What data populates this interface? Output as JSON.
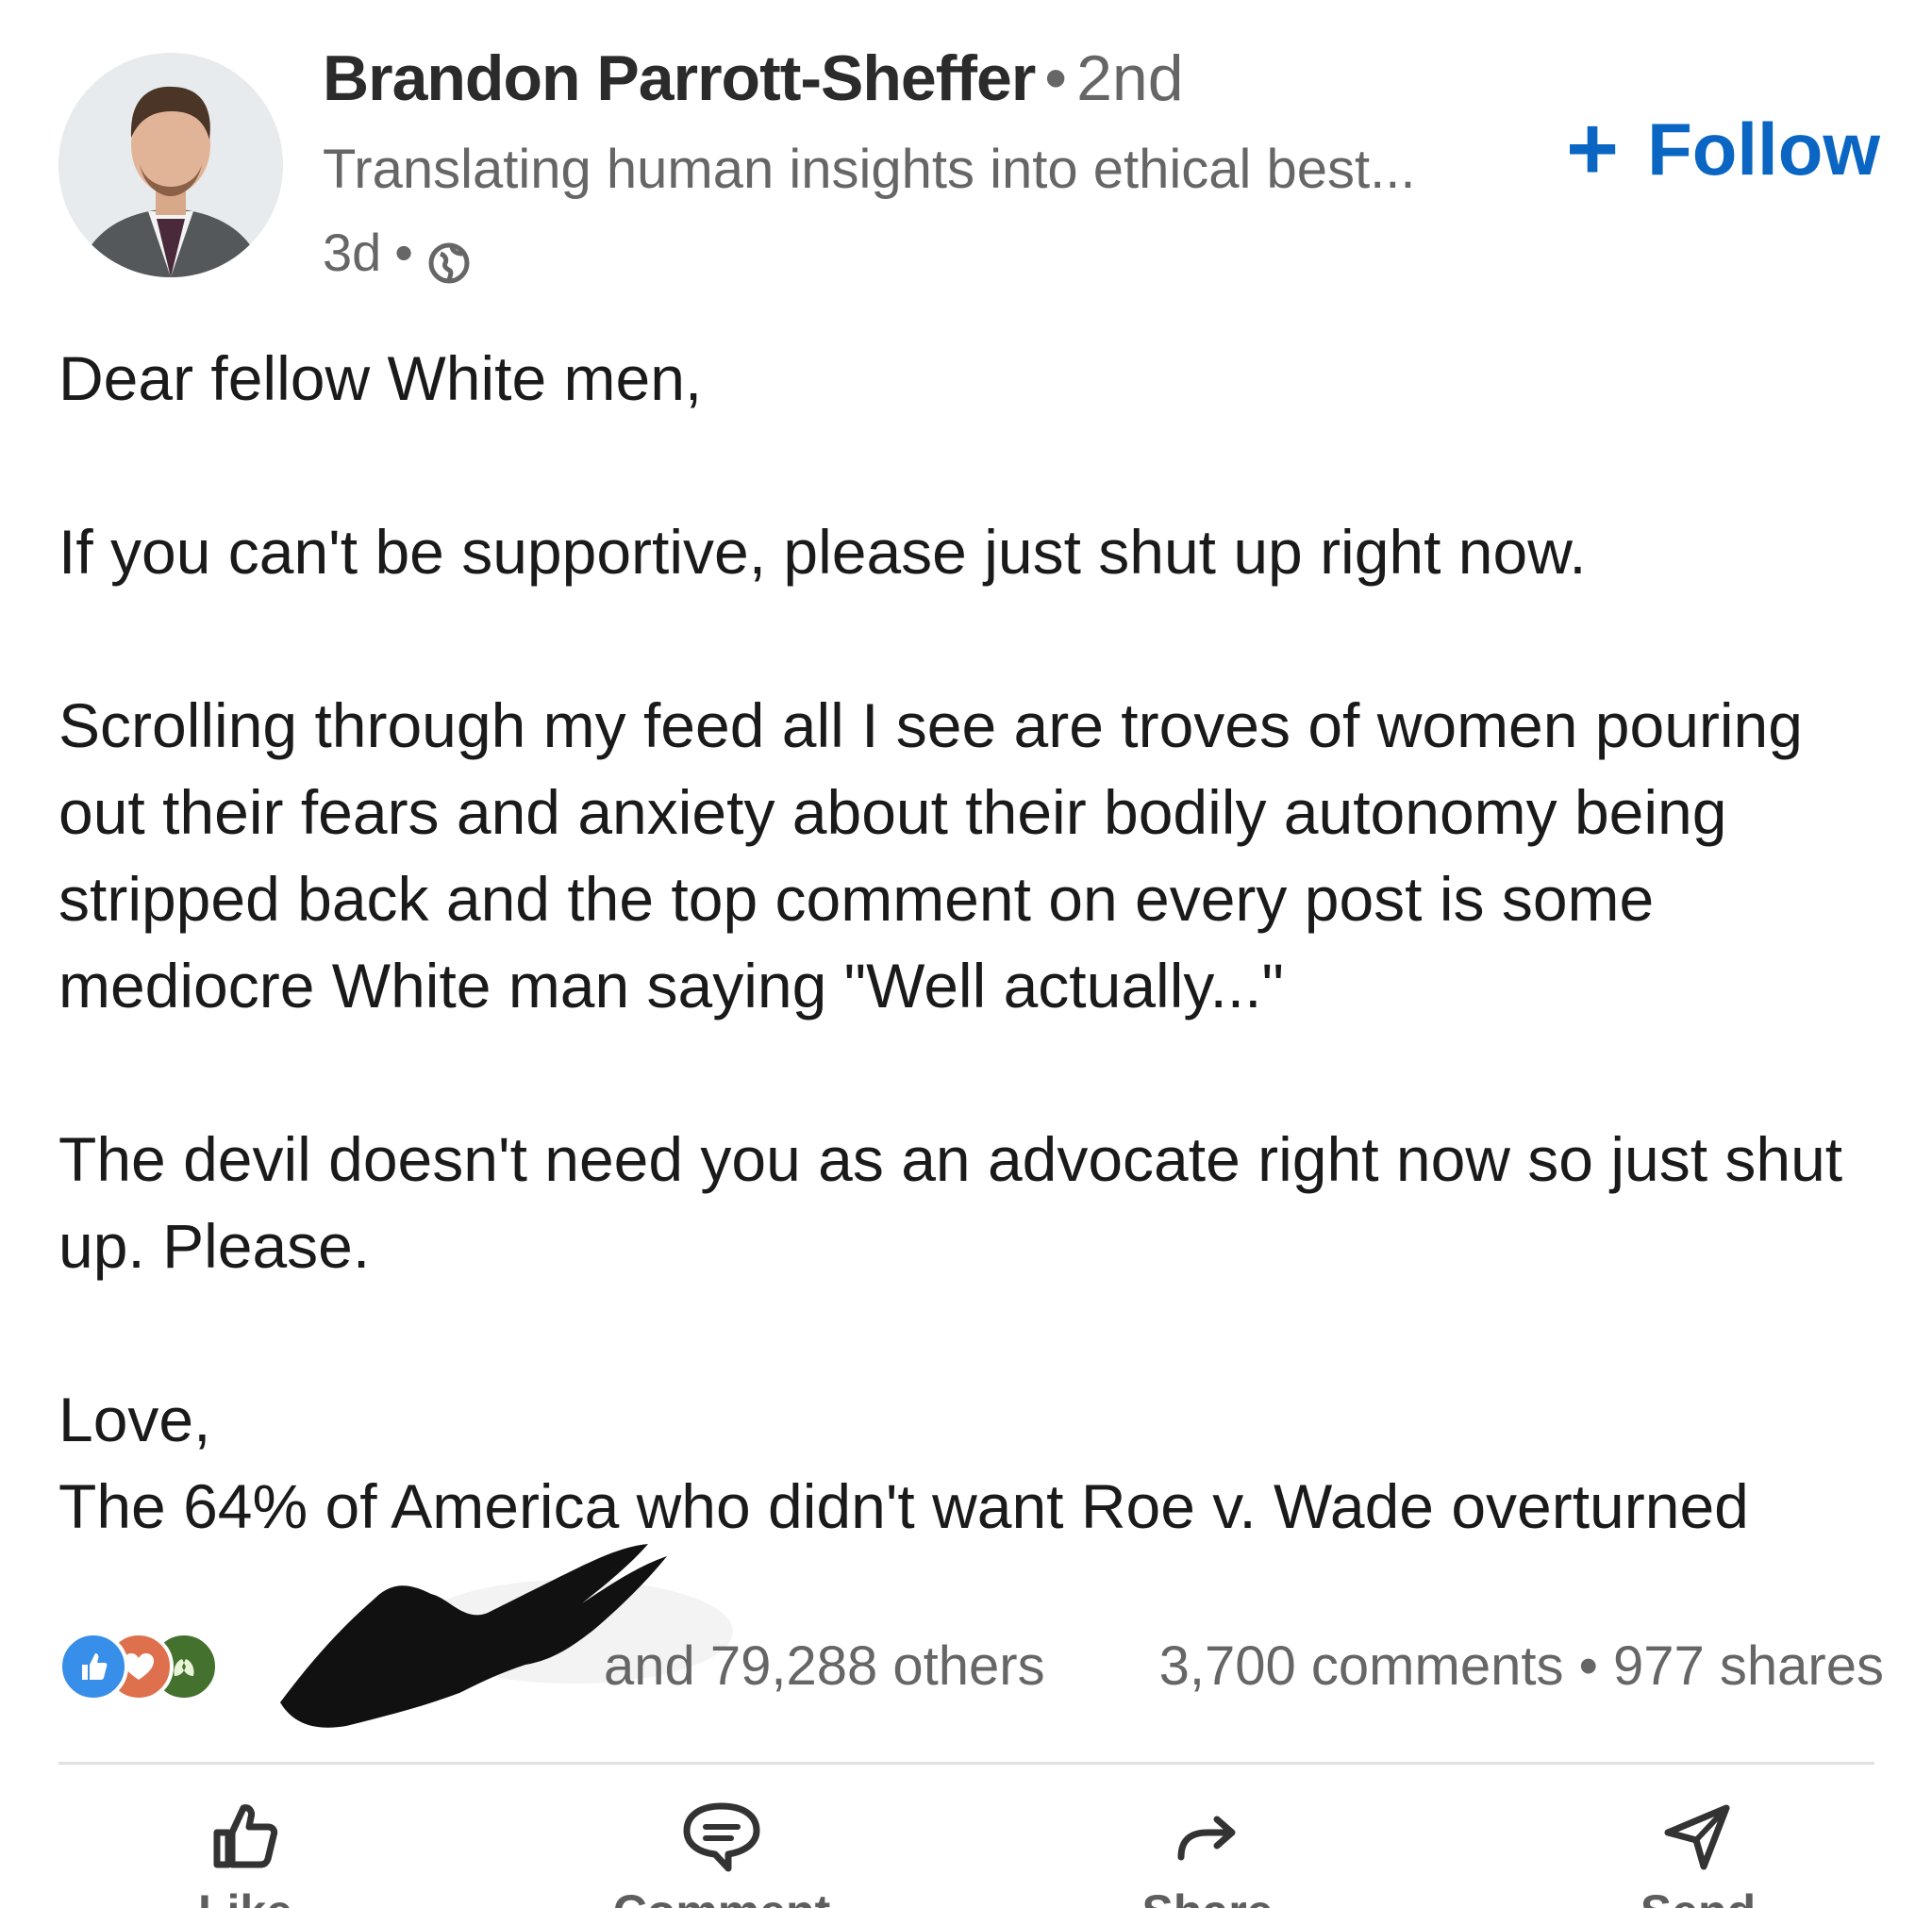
{
  "post": {
    "author": {
      "name": "Brandon Parrott-Sheffer",
      "separator": "•",
      "degree": "2nd",
      "headline": "Translating human insights into ethical best...",
      "age": "3d",
      "visibility_icon": "globe-icon"
    },
    "follow": {
      "icon": "plus-icon",
      "label": "Follow"
    },
    "body": {
      "greeting": "Dear fellow White men,",
      "paragraph_1": "If you can't be supportive, please just shut up right now.",
      "paragraph_2": "Scrolling through my feed all I see are troves of women pouring out their fears and anxiety about their bodily autonomy being stripped back and the top comment on every post is some mediocre White man saying \"Well actually...\"",
      "paragraph_3": "The devil doesn't need you as an advocate right now so just shut up. Please.",
      "signoff": "Love,",
      "signature": "The 64% of America who didn't want Roe v. Wade overturned"
    },
    "social": {
      "reactions": [
        "like-icon",
        "love-icon",
        "celebrate-icon"
      ],
      "reaction_text": "and 79,288 others",
      "comments": "3,700 comments",
      "stats_separator": "•",
      "shares": "977 shares"
    },
    "actions": [
      {
        "icon": "thumbs-up-icon",
        "label": "Like"
      },
      {
        "icon": "comment-icon",
        "label": "Comment"
      },
      {
        "icon": "share-arrow-icon",
        "label": "Share"
      },
      {
        "icon": "send-icon",
        "label": "Send"
      }
    ],
    "colors": {
      "accent": "#0a66c2",
      "muted_text": "#666666",
      "body_text": "#1a1a1a"
    }
  }
}
